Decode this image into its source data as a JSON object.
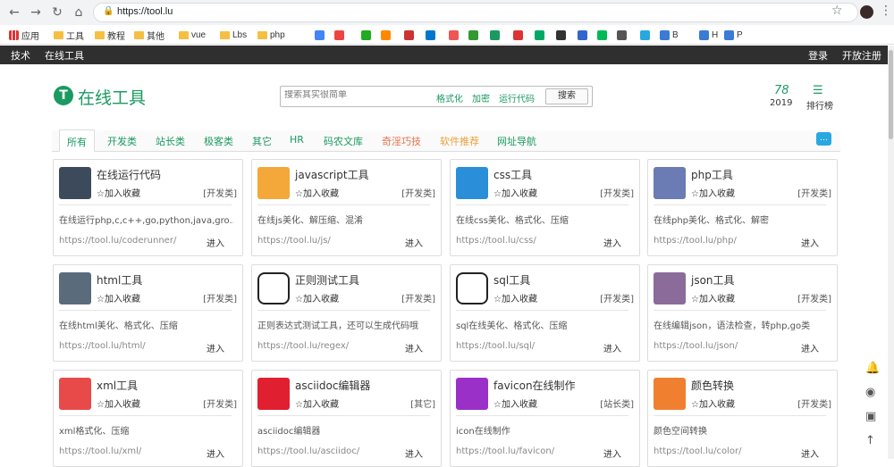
{
  "browser": {
    "url": "https://tool.lu",
    "bookmarks": [
      {
        "label": "应用",
        "icon": "apps-grid-icon"
      },
      {
        "label": "工具",
        "icon": "folder-icon"
      },
      {
        "label": "教程",
        "icon": "folder-icon"
      },
      {
        "label": "其他",
        "icon": "folder-icon"
      },
      {
        "label": "vue",
        "icon": "folder-icon"
      },
      {
        "label": "Lbs",
        "icon": "folder-icon"
      },
      {
        "label": "php",
        "icon": "folder-icon"
      },
      {
        "label": "B",
        "icon": "site-icon"
      },
      {
        "label": "H",
        "icon": "site-icon"
      },
      {
        "label": "P",
        "icon": "site-icon"
      }
    ]
  },
  "topbar": {
    "left": [
      "技术",
      "在线工具"
    ],
    "right": [
      "登录",
      "开放注册"
    ]
  },
  "header": {
    "logo_letter": "T",
    "title": "在线工具",
    "search_placeholder": "搜索其实很简单",
    "quick_tags": [
      "格式化",
      "加密",
      "运行代码"
    ],
    "search_button": "搜索",
    "year_number": "78",
    "year_label": "2019",
    "rank_label": "排行榜"
  },
  "tabs": [
    {
      "label": "所有",
      "color": "#1a9a60"
    },
    {
      "label": "开发类",
      "color": "#1a9a60"
    },
    {
      "label": "站长类",
      "color": "#1a9a60"
    },
    {
      "label": "极客类",
      "color": "#1a9a60"
    },
    {
      "label": "其它",
      "color": "#1a9a60"
    },
    {
      "label": "HR",
      "color": "#1a9a60"
    },
    {
      "label": "码农文库",
      "color": "#1a9a60"
    },
    {
      "label": "奇淫巧技",
      "color": "#e8724a"
    },
    {
      "label": "软件推荐",
      "color": "#e8a23a"
    },
    {
      "label": "网址导航",
      "color": "#1a9a60"
    }
  ],
  "fav_label": "☆加入收藏",
  "go_label": "进入",
  "cards": [
    {
      "name": "在线运行代码",
      "cat": "[开发类]",
      "desc": "在线运行php,c,c++,go,python,java,gro...",
      "link": "https://tool.lu/coderunner/",
      "icon": "code-runner-icon",
      "color": "#3d4a5c"
    },
    {
      "name": "javascript工具",
      "cat": "[开发类]",
      "desc": "在线js美化、解压缩、混淆",
      "link": "https://tool.lu/js/",
      "icon": "js-file-icon",
      "color": "#f4a83a"
    },
    {
      "name": "css工具",
      "cat": "[开发类]",
      "desc": "在线css美化、格式化、压缩",
      "link": "https://tool.lu/css/",
      "icon": "css-file-icon",
      "color": "#2a8fd8"
    },
    {
      "name": "php工具",
      "cat": "[开发类]",
      "desc": "在线php美化、格式化、解密",
      "link": "https://tool.lu/php/",
      "icon": "php-icon",
      "color": "#6b7bb3"
    },
    {
      "name": "html工具",
      "cat": "[开发类]",
      "desc": "在线html美化、格式化、压缩",
      "link": "https://tool.lu/html/",
      "icon": "html-editor-icon",
      "color": "#5a6b7c"
    },
    {
      "name": "正则测试工具",
      "cat": "[开发类]",
      "desc": "正则表达式测试工具，还可以生成代码哦",
      "link": "https://tool.lu/regex/",
      "icon": "regex-icon",
      "color": "#ffffff"
    },
    {
      "name": "sql工具",
      "cat": "[开发类]",
      "desc": "sql在线美化、格式化、压缩",
      "link": "https://tool.lu/sql/",
      "icon": "sql-icon",
      "color": "#ffffff"
    },
    {
      "name": "json工具",
      "cat": "[开发类]",
      "desc": "在线编辑json，语法检查，转php,go类",
      "link": "https://tool.lu/json/",
      "icon": "json-file-icon",
      "color": "#8a6b9a"
    },
    {
      "name": "xml工具",
      "cat": "[开发类]",
      "desc": "xml格式化、压缩",
      "link": "https://tool.lu/xml/",
      "icon": "xml-file-icon",
      "color": "#e84a4a"
    },
    {
      "name": "asciidoc编辑器",
      "cat": "[其它]",
      "desc": "asciidoc编辑器",
      "link": "https://tool.lu/asciidoc/",
      "icon": "asciidoc-icon",
      "color": "#e02030"
    },
    {
      "name": "favicon在线制作",
      "cat": "[站长类]",
      "desc": "icon在线制作",
      "link": "https://tool.lu/favicon/",
      "icon": "favicon-icon",
      "color": "#9b30c8"
    },
    {
      "name": "颜色转换",
      "cat": "[开发类]",
      "desc": "颜色空间转换",
      "link": "https://tool.lu/color/",
      "icon": "color-palette-icon",
      "color": "#f08030"
    }
  ]
}
